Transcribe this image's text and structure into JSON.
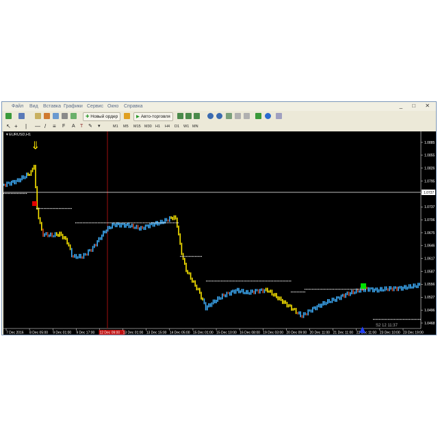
{
  "menu": [
    "Файл",
    "Вид",
    "Вставка",
    "Графики",
    "Сервис",
    "Окно",
    "Справка"
  ],
  "toolbar": {
    "new_order_label": "Новый ордер",
    "autotrade_label": "Авто-торговля",
    "timeframes": [
      "M1",
      "M5",
      "M15",
      "M30",
      "H1",
      "H4",
      "D1",
      "W1",
      "MN"
    ]
  },
  "chart": {
    "symbol_label": "EURUSD,H1",
    "current_price": "1.0727",
    "countdown": "S2 12 11:37",
    "price_ticks": [
      "1.0885",
      "1.0855",
      "1.0826",
      "1.0795",
      "1.0765",
      "1.0737",
      "1.0706",
      "1.0675",
      "1.0646",
      "1.0617",
      "1.0587",
      "1.0556",
      "1.0527",
      "1.0496",
      "1.0468"
    ],
    "time_ticks": [
      "7 Dec 2016",
      "8 Dec 05:00",
      "9 Dec 01:00",
      "9 Dec 17:00",
      "12 Dec 09:00",
      "13 Dec 01:00",
      "13 Dec 15:00",
      "14 Dec 05:00",
      "15 Dec 01:00",
      "15 Dec 10:00",
      "16 Dec 08:00",
      "19 Dec 03:00",
      "20 Dec 09:00",
      "20 Dec 11:00",
      "21 Dec 11:00",
      "22 Dec 11:00",
      "23 Dec 10:00",
      "23 Dec 19:00"
    ],
    "highlighted_time_tick_index": 4,
    "colors": {
      "background": "#000000",
      "candle_up": "#3fb0ff",
      "candle_down": "#ffe800",
      "candle_red": "#c8401a",
      "signal_dots": "#ffffff",
      "buy_marker": "#00e000",
      "sell_marker": "#e00000",
      "arrow_down": "#ffe800",
      "arrow_up": "#2040ff"
    }
  }
}
